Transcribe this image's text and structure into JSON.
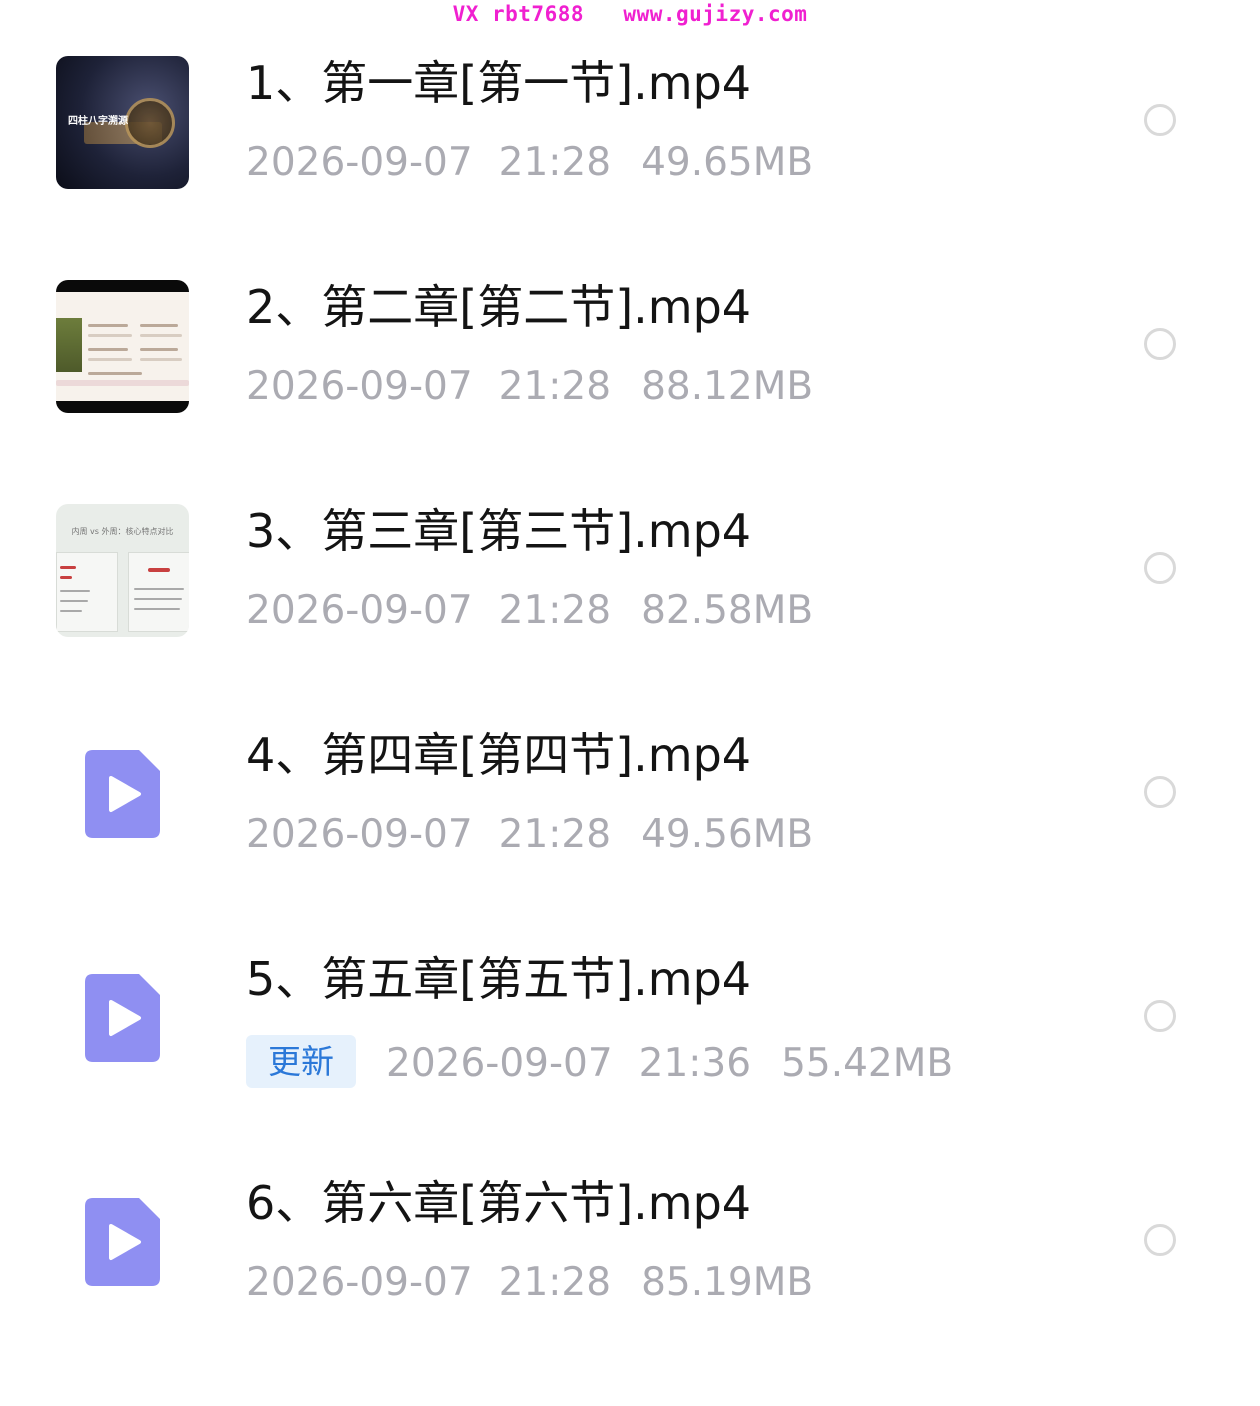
{
  "watermark": "VX rbt7688   www.gujizy.com",
  "files": [
    {
      "name": "1、第一章[第一节].mp4",
      "date": "2026-09-07",
      "time": "21:28",
      "size": "49.65MB",
      "thumbnail": "video-frame",
      "thumb_title": "四柱八字溯源"
    },
    {
      "name": "2、第二章[第二节].mp4",
      "date": "2026-09-07",
      "time": "21:28",
      "size": "88.12MB",
      "thumbnail": "video-frame"
    },
    {
      "name": "3、第三章[第三节].mp4",
      "date": "2026-09-07",
      "time": "21:28",
      "size": "82.58MB",
      "thumbnail": "video-frame",
      "thumb_title": "内周 vs 外周：核心特点对比"
    },
    {
      "name": "4、第四章[第四节].mp4",
      "date": "2026-09-07",
      "time": "21:28",
      "size": "49.56MB",
      "thumbnail": "play-file-icon"
    },
    {
      "name": "5、第五章[第五节].mp4",
      "badge": "更新",
      "date": "2026-09-07",
      "time": "21:36",
      "size": "55.42MB",
      "thumbnail": "play-file-icon"
    },
    {
      "name": "6、第六章[第六节].mp4",
      "date": "2026-09-07",
      "time": "21:28",
      "size": "85.19MB",
      "thumbnail": "play-file-icon"
    }
  ],
  "colors": {
    "title_text": "#141414",
    "meta_text": "#ababb2",
    "icon_fill": "#8f8ff2",
    "badge_bg": "#e6f1fc",
    "badge_text": "#2b78d8",
    "watermark": "#f020d0",
    "circle_border": "#d9d9d9"
  }
}
